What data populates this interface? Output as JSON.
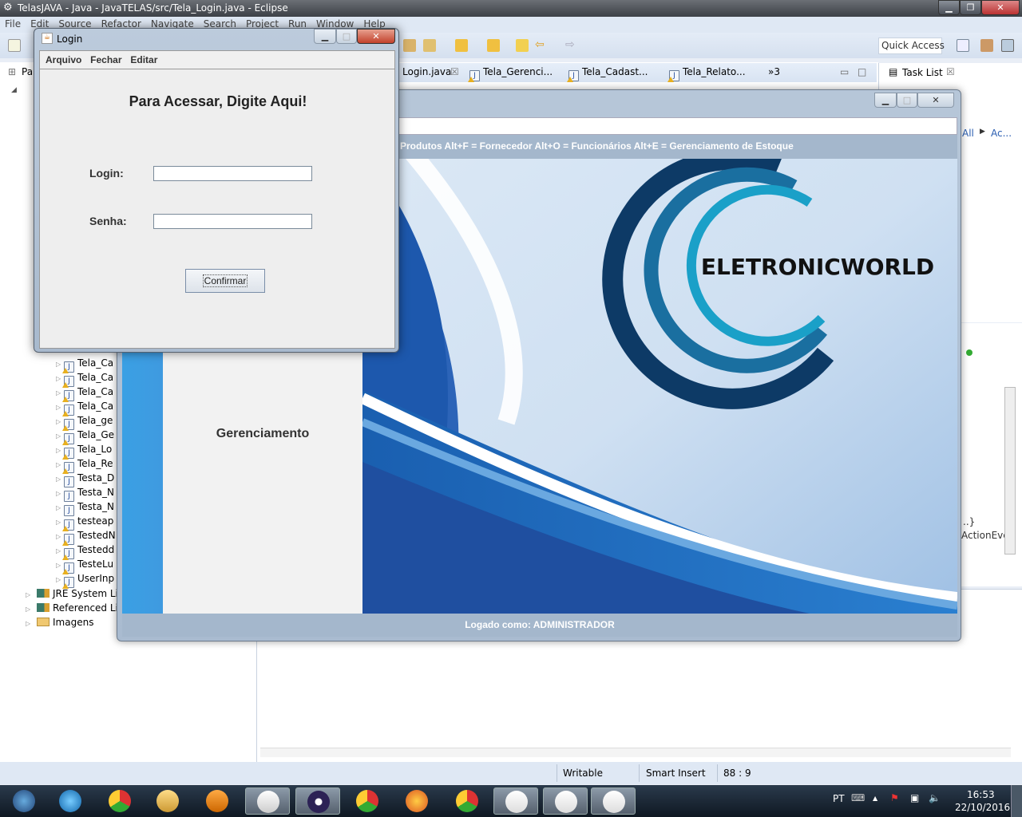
{
  "eclipse": {
    "title": "TelasJAVA - Java - JavaTELAS/src/Tela_Login.java - Eclipse",
    "menu": [
      "File",
      "Edit",
      "Source",
      "Refactor",
      "Navigate",
      "Search",
      "Project",
      "Run",
      "Window",
      "Help"
    ],
    "quick_access": "Quick Access",
    "package_tab": "Pa",
    "tree_files": [
      {
        "label": "Tela_Ca",
        "warn": true
      },
      {
        "label": "Tela_Ca",
        "warn": true
      },
      {
        "label": "Tela_Ca",
        "warn": true
      },
      {
        "label": "Tela_Ca",
        "warn": true
      },
      {
        "label": "Tela_ge",
        "warn": true
      },
      {
        "label": "Tela_Ge",
        "warn": true
      },
      {
        "label": "Tela_Lo",
        "warn": true
      },
      {
        "label": "Tela_Re",
        "warn": true
      },
      {
        "label": "Testa_D",
        "warn": false
      },
      {
        "label": "Testa_N",
        "warn": false
      },
      {
        "label": "Testa_N",
        "warn": false
      },
      {
        "label": "testeap",
        "warn": true
      },
      {
        "label": "TestedN",
        "warn": true
      },
      {
        "label": "Testedd",
        "warn": true
      },
      {
        "label": "TesteLu",
        "warn": true
      },
      {
        "label": "UserInp",
        "warn": true
      }
    ],
    "tree_libs": [
      {
        "label": "JRE System Lib",
        "icon": "library-icon"
      },
      {
        "label": "Referenced Lib",
        "icon": "library-icon"
      },
      {
        "label": "Imagens",
        "icon": "folder-icon"
      }
    ],
    "editor_tabs": [
      {
        "label": "Login.java",
        "close": "☒"
      },
      {
        "label": "Tela_Gerenci..."
      },
      {
        "label": "Tela_Cadast..."
      },
      {
        "label": "Tela_Relato..."
      }
    ],
    "more_tabs": "»3",
    "task_list": "Task List",
    "task_links": [
      "All",
      "Ac..."
    ],
    "outline_snippets": [
      "..}",
      "ActionEve"
    ],
    "status": {
      "writable": "Writable",
      "insert": "Smart Insert",
      "position": "88 : 9"
    }
  },
  "app": {
    "shortcuts": "Produtos  Alt+F = Fornecedor  Alt+O = Funcionários  Alt+E = Gerenciamento de Estoque",
    "panel_title": "Gerenciamento",
    "logo_text": "ELETRONICWORLD",
    "footer": "Logado como: ADMINISTRADOR"
  },
  "login": {
    "title": "Login",
    "menu": [
      "Arquivo",
      "Fechar",
      "Editar"
    ],
    "heading": "Para Acessar, Digite Aqui!",
    "login_label": "Login:",
    "login_value": "",
    "senha_label": "Senha:",
    "senha_value": "",
    "confirm": "Confirmar"
  },
  "taskbar": {
    "apps": [
      "start",
      "internet-explorer",
      "chrome",
      "file-explorer",
      "media-player",
      "notepad",
      "eclipse",
      "chrome",
      "firefox",
      "chrome",
      "java",
      "java",
      "java"
    ],
    "lang": "PT",
    "time": "16:53",
    "date": "22/10/2016"
  },
  "colors": {
    "accent": "#3aa0e4",
    "header": "#a4b7cc",
    "logo_dark": "#0d3a66",
    "logo_teal": "#1a8fb8"
  }
}
